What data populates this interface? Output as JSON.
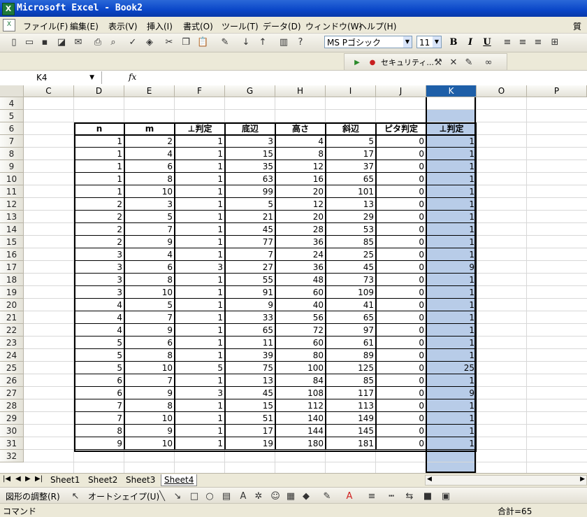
{
  "window": {
    "title": "Microsoft Excel - Book2",
    "app_icon": "X"
  },
  "menu": [
    "ファイル(F)",
    "編集(E)",
    "表示(V)",
    "挿入(I)",
    "書式(O)",
    "ツール(T)",
    "データ(D)",
    "ウィンドウ(W)",
    "ヘルプ(H)"
  ],
  "menu_overflow": "質問",
  "toolbar": {
    "font": "MS Pゴシック",
    "font_size": "11",
    "bold": "B",
    "italic": "I",
    "underline": "U"
  },
  "security_toolbar": {
    "label": "セキュリティ..."
  },
  "formula_bar": {
    "name_box": "K4",
    "fx": "fx",
    "content": ""
  },
  "columns": [
    "C",
    "D",
    "E",
    "F",
    "G",
    "H",
    "I",
    "J",
    "K",
    "O",
    "P"
  ],
  "selected_column": "K",
  "rows": [
    "4",
    "5",
    "6",
    "7",
    "8",
    "9",
    "10",
    "11",
    "12",
    "13",
    "14",
    "15",
    "16",
    "17",
    "18",
    "19",
    "20",
    "21",
    "22",
    "23",
    "24",
    "25",
    "26",
    "27",
    "28",
    "29",
    "30",
    "31",
    "32"
  ],
  "table": {
    "headers": [
      "n",
      "m",
      "⊥判定",
      "底辺",
      "高さ",
      "斜辺",
      "ピタ判定",
      "⊥判定"
    ],
    "data": [
      [
        "1",
        "2",
        "1",
        "3",
        "4",
        "5",
        "0",
        "1"
      ],
      [
        "1",
        "4",
        "1",
        "15",
        "8",
        "17",
        "0",
        "1"
      ],
      [
        "1",
        "6",
        "1",
        "35",
        "12",
        "37",
        "0",
        "1"
      ],
      [
        "1",
        "8",
        "1",
        "63",
        "16",
        "65",
        "0",
        "1"
      ],
      [
        "1",
        "10",
        "1",
        "99",
        "20",
        "101",
        "0",
        "1"
      ],
      [
        "2",
        "3",
        "1",
        "5",
        "12",
        "13",
        "0",
        "1"
      ],
      [
        "2",
        "5",
        "1",
        "21",
        "20",
        "29",
        "0",
        "1"
      ],
      [
        "2",
        "7",
        "1",
        "45",
        "28",
        "53",
        "0",
        "1"
      ],
      [
        "2",
        "9",
        "1",
        "77",
        "36",
        "85",
        "0",
        "1"
      ],
      [
        "3",
        "4",
        "1",
        "7",
        "24",
        "25",
        "0",
        "1"
      ],
      [
        "3",
        "6",
        "3",
        "27",
        "36",
        "45",
        "0",
        "9"
      ],
      [
        "3",
        "8",
        "1",
        "55",
        "48",
        "73",
        "0",
        "1"
      ],
      [
        "3",
        "10",
        "1",
        "91",
        "60",
        "109",
        "0",
        "1"
      ],
      [
        "4",
        "5",
        "1",
        "9",
        "40",
        "41",
        "0",
        "1"
      ],
      [
        "4",
        "7",
        "1",
        "33",
        "56",
        "65",
        "0",
        "1"
      ],
      [
        "4",
        "9",
        "1",
        "65",
        "72",
        "97",
        "0",
        "1"
      ],
      [
        "5",
        "6",
        "1",
        "11",
        "60",
        "61",
        "0",
        "1"
      ],
      [
        "5",
        "8",
        "1",
        "39",
        "80",
        "89",
        "0",
        "1"
      ],
      [
        "5",
        "10",
        "5",
        "75",
        "100",
        "125",
        "0",
        "25"
      ],
      [
        "6",
        "7",
        "1",
        "13",
        "84",
        "85",
        "0",
        "1"
      ],
      [
        "6",
        "9",
        "3",
        "45",
        "108",
        "117",
        "0",
        "9"
      ],
      [
        "7",
        "8",
        "1",
        "15",
        "112",
        "113",
        "0",
        "1"
      ],
      [
        "7",
        "10",
        "1",
        "51",
        "140",
        "149",
        "0",
        "1"
      ],
      [
        "8",
        "9",
        "1",
        "17",
        "144",
        "145",
        "0",
        "1"
      ],
      [
        "9",
        "10",
        "1",
        "19",
        "180",
        "181",
        "0",
        "1"
      ]
    ]
  },
  "sheets": [
    "Sheet1",
    "Sheet2",
    "Sheet3",
    "Sheet4"
  ],
  "active_sheet": "Sheet4",
  "draw_toolbar": {
    "draw": "図形の調整(R)",
    "autoshape": "オートシェイプ(U)"
  },
  "status": {
    "mode": "コマンド",
    "sum": "合計=65"
  }
}
